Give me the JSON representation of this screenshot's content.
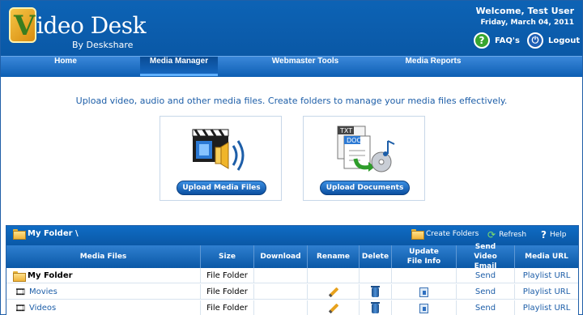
{
  "header": {
    "logo_letter": "V",
    "logo_title": "ideo Desk",
    "logo_subtitle": "By Deskshare",
    "welcome": "Welcome, Test User",
    "date": "Friday, March 04, 2011",
    "faq_label": "FAQ's",
    "faq_icon": "help-circle-icon",
    "logout_label": "Logout",
    "logout_icon": "power-icon"
  },
  "nav": {
    "items": [
      {
        "label": "Home"
      },
      {
        "label": "Media Manager",
        "active": true
      },
      {
        "label": "Webmaster Tools"
      },
      {
        "label": "Media Reports"
      }
    ]
  },
  "intro_text": "Upload video, audio and other media files. Create folders to manage your media files effectively.",
  "upload": {
    "media_button": "Upload Media Files",
    "documents_button": "Upload Documents",
    "doc_tags": [
      "TXT",
      "DOC"
    ]
  },
  "panel": {
    "breadcrumb": "My Folder \\",
    "create_folders": "Create Folders",
    "refresh": "Refresh",
    "help": "Help",
    "columns": [
      "Media Files",
      "Size",
      "Download",
      "Rename",
      "Delete",
      "Update File Info",
      "Send Video Email",
      "Media URL"
    ],
    "rows": [
      {
        "name": "My Folder",
        "size": "File Folder",
        "send": "Send",
        "url": "Playlist URL"
      },
      {
        "name": "Movies",
        "size": "File Folder",
        "send": "Send",
        "url": "Playlist URL"
      },
      {
        "name": "Videos",
        "size": "File Folder",
        "send": "Send",
        "url": "Playlist URL"
      }
    ]
  },
  "colors": {
    "header_blue": "#0a58a6",
    "link_blue": "#1d5ea8",
    "faq_green": "#38a530"
  }
}
